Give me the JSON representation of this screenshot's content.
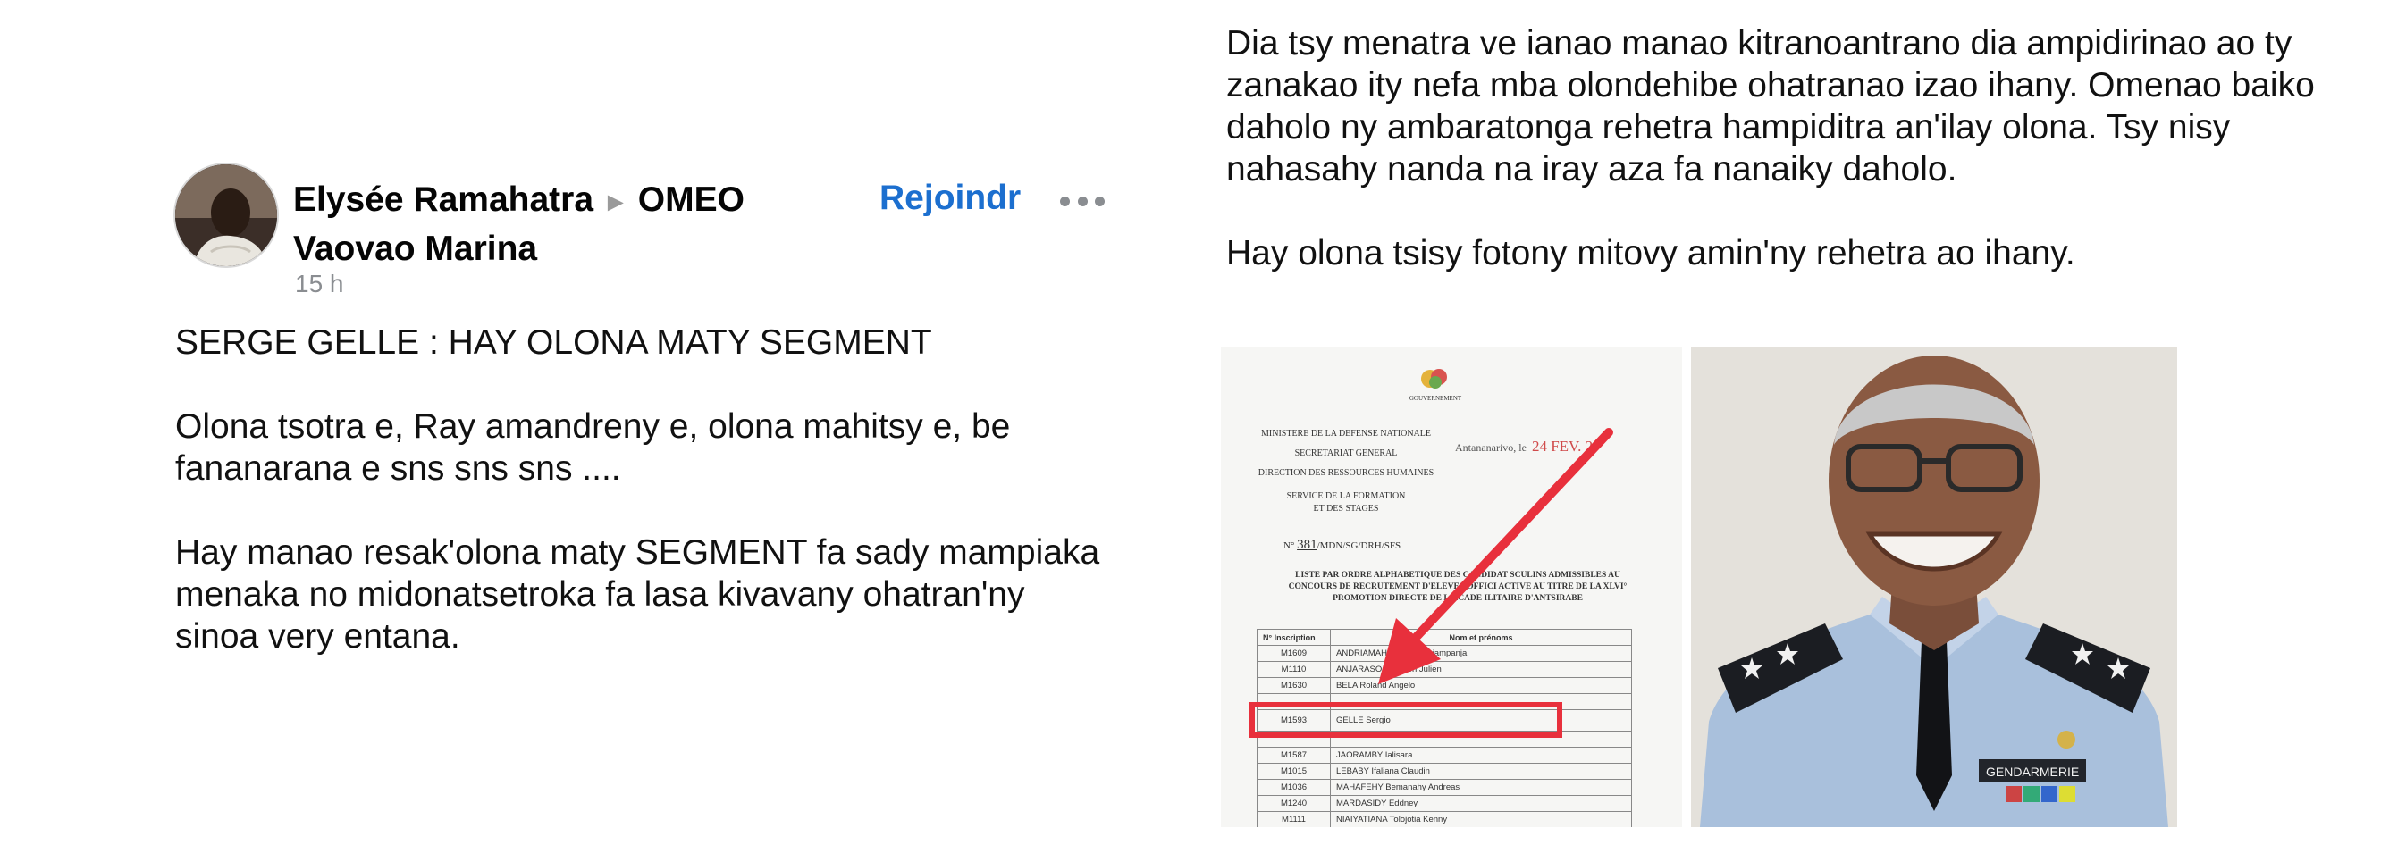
{
  "post": {
    "author": "Elysée Ramahatra",
    "arrow_icon": "triangle-right-icon",
    "group": "OMEO Vaovao Marina",
    "time": "15 h",
    "join_label": "Rejoindr",
    "more_icon": "more-dots-icon",
    "paragraphs": [
      "SERGE GELLE : HAY OLONA MATY SEGMENT",
      "Olona tsotra e, Ray amandreny e, olona mahitsy e, be fananarana e sns sns sns ....",
      "Hay manao resak'olona maty SEGMENT fa sady mampiaka menaka no midonatsetroka fa lasa kivavany ohatran'ny sinoa very entana."
    ],
    "right_paragraphs": [
      "Dia tsy menatra ve ianao manao kitranoantrano dia ampidirinao ao ty zanakao ity nefa mba olondehibe ohatranao izao ihany. Omenao baiko daholo ny ambaratonga rehetra hampiditra an'ilay olona. Tsy nisy nahasahy nanda na iray aza fa nanaiky daholo.",
      "Hay olona tsisy fotony mitovy amin'ny rehetra ao ihany."
    ]
  },
  "document": {
    "header_small": "GOUVERNEMENT",
    "ministry_lines": [
      "MINISTERE DE LA DEFENSE NATIONALE",
      "SECRETARIAT GENERAL",
      "DIRECTION DES RESSOURCES HUMAINES",
      "SERVICE DE LA FORMATION",
      "ET DES STAGES"
    ],
    "city": "Antananarivo, le",
    "date": "24 FEV. 2",
    "ref_prefix": "N°",
    "ref_number": "381",
    "ref_suffix": "/MDN/SG/DRH/SFS",
    "list_title": "LISTE PAR ORDRE ALPHABETIQUE DES CANDIDAT   SCULINS ADMISSIBLES AU CONCOURS DE RECRUTEMENT D'ELEVES-OFFICI   ACTIVE AU TITRE DE LA XLVI° PROMOTION DIRECTE DE L'ACADE   ILITAIRE D'ANTSIRABE",
    "columns": [
      "N° Inscription",
      "Nom et prénoms"
    ],
    "rows": [
      [
        "M1609",
        "ANDRIAMAHEN        ino Andriampanja"
      ],
      [
        "M1110",
        "ANJARASOA M          ction Julien"
      ],
      [
        "M1630",
        "BELA Roland Angelo"
      ],
      [
        "",
        ""
      ],
      [
        "M1593",
        "GELLE Sergio"
      ],
      [
        "",
        ""
      ],
      [
        "M1587",
        "JAORAMBY Ialisara"
      ],
      [
        "M1015",
        "LEBABY Ifaliana Claudin"
      ],
      [
        "M1036",
        "MAHAFEHY Bemanahy Andreas"
      ],
      [
        "M1240",
        "MARDASIDY Eddney"
      ],
      [
        "M1111",
        "NIAIYATIANA Tolojotia Kenny"
      ]
    ]
  },
  "photo": {
    "badge_text": "GENDARMERIE"
  },
  "colors": {
    "link_blue": "#1c6fcf",
    "highlight_red": "#e8303c",
    "meta_gray": "#8a8d91"
  }
}
